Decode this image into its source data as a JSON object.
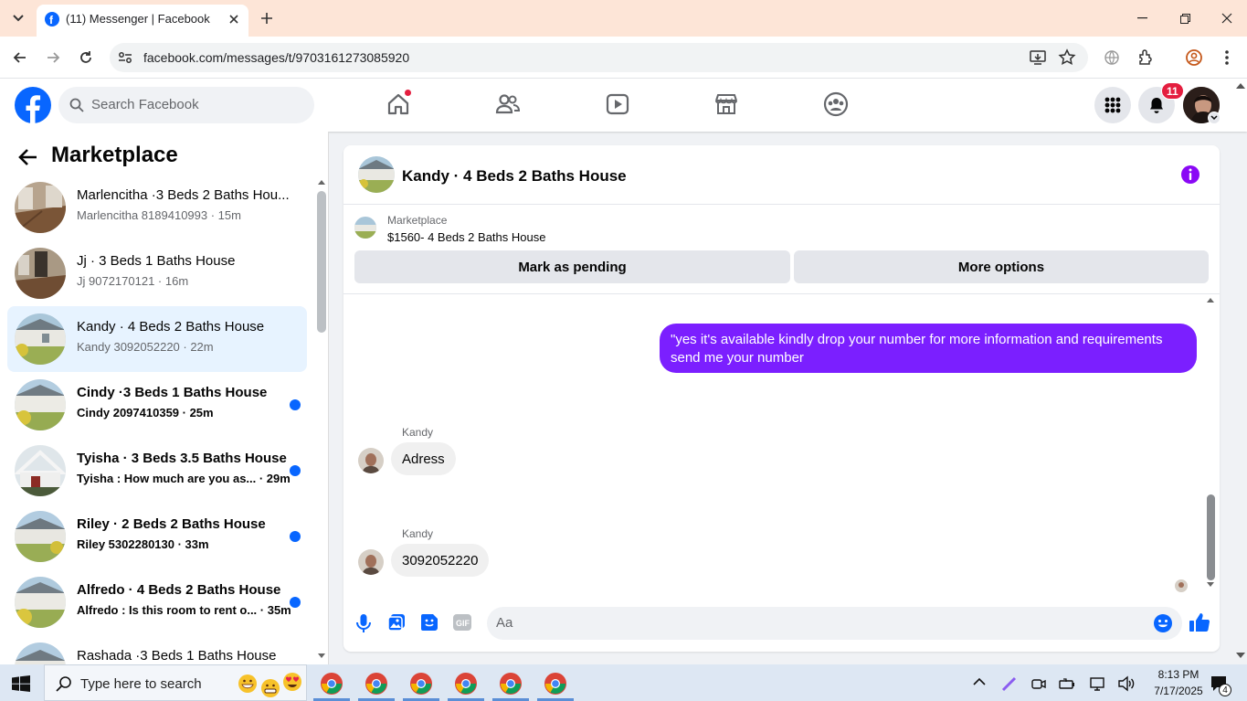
{
  "browser": {
    "tab_title": "(11) Messenger | Facebook",
    "url": "facebook.com/messages/t/9703161273085920",
    "icons": [
      "chevron-down-icon",
      "facebook-favicon",
      "close-icon",
      "plus-icon",
      "minimize-icon",
      "restore-icon",
      "close-window-icon",
      "back-icon",
      "forward-icon",
      "reload-icon",
      "site-info-icon",
      "install-icon",
      "star-icon",
      "translate-icon",
      "extensions-icon",
      "profile-icon",
      "menu-icon"
    ]
  },
  "fb": {
    "search_placeholder": "Search Facebook",
    "notification_count": "11",
    "brand_color": "#0866ff"
  },
  "sidebar": {
    "title": "Marketplace",
    "conversations": [
      {
        "title": "Marlencitha ·3 Beds 2 Baths Hou...",
        "subtitle": "Marlencitha 8189410993 · 15m",
        "unread": false,
        "selected": false
      },
      {
        "title": "Jj · 3 Beds 1 Baths House",
        "subtitle": "Jj 9072170121 · 16m",
        "unread": false,
        "selected": false
      },
      {
        "title": "Kandy · 4 Beds 2 Baths House",
        "subtitle": "Kandy 3092052220 · 22m",
        "unread": false,
        "selected": true
      },
      {
        "title": "Cindy ·3 Beds 1 Baths House",
        "subtitle": "Cindy 2097410359 · 25m",
        "unread": true,
        "selected": false
      },
      {
        "title": "Tyisha · 3 Beds 3.5 Baths House",
        "subtitle": "Tyisha : How much are you as...   · 29m",
        "unread": true,
        "selected": false
      },
      {
        "title": "Riley · 2 Beds 2 Baths House",
        "subtitle": "Riley 5302280130 · 33m",
        "unread": true,
        "selected": false
      },
      {
        "title": "Alfredo · 4 Beds 2 Baths House",
        "subtitle": "Alfredo : Is this room to rent o... · 35m",
        "unread": true,
        "selected": false
      },
      {
        "title": "Rashada ·3 Beds 1 Baths House",
        "subtitle": "",
        "unread": false,
        "selected": false
      }
    ]
  },
  "chat": {
    "title": "Kandy · 4 Beds 2 Baths House",
    "listing_label": "Marketplace",
    "listing_price": "$1560- 4 Beds 2 Baths House",
    "mark_pending": "Mark as pending",
    "more_options": "More options",
    "messages": [
      {
        "direction": "out",
        "text": "\"yes it's available kindly drop your number for more information and requirements send me your number"
      },
      {
        "direction": "in",
        "sender": "Kandy",
        "text": "Adress"
      },
      {
        "direction": "in",
        "sender": "Kandy",
        "text": "3092052220"
      }
    ],
    "composer_placeholder": "Aa",
    "accent": "#7b1fff"
  },
  "taskbar": {
    "search_placeholder": "Type here to search",
    "time": "8:13 PM",
    "date": "7/17/2025",
    "notification_count": "4"
  }
}
